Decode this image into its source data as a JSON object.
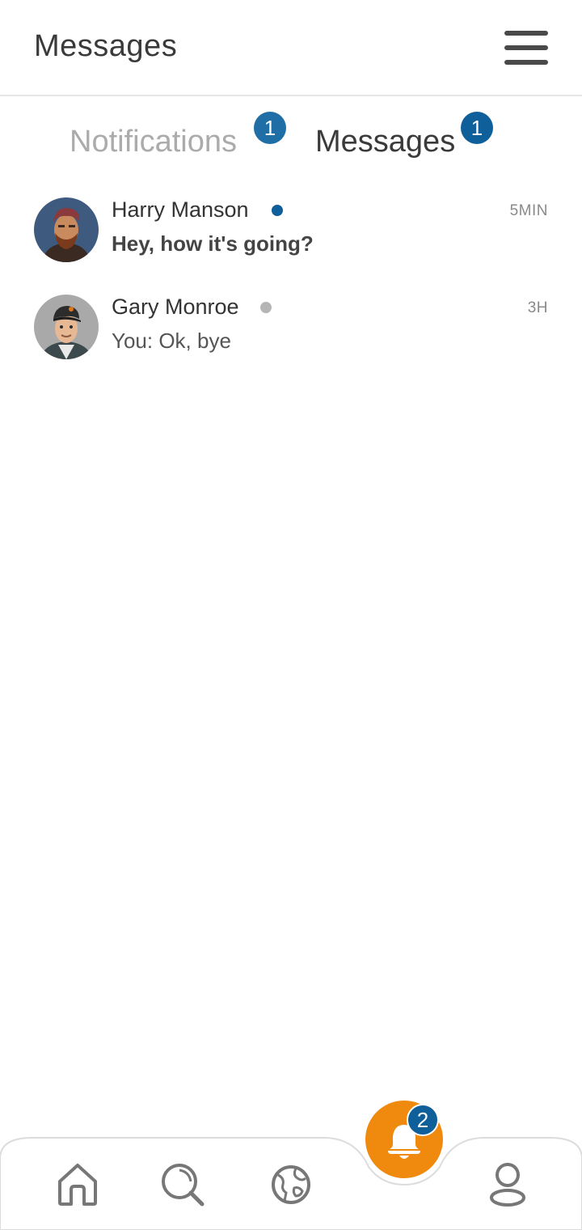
{
  "header": {
    "title": "Messages",
    "menu_icon": "hamburger-menu-icon"
  },
  "tabs": [
    {
      "label": "Notifications",
      "badge": "1",
      "active": false
    },
    {
      "label": "Messages",
      "badge": "1",
      "active": true
    }
  ],
  "conversations": [
    {
      "name": "Harry Manson",
      "preview": "Hey, how it's going?",
      "time": "5MIN",
      "online": true,
      "unread": true,
      "status_color": "#0f5f9b"
    },
    {
      "name": "Gary Monroe",
      "preview": "You: Ok, bye",
      "time": "3H",
      "online": false,
      "unread": false,
      "status_color": "#b5b5b5"
    }
  ],
  "bottom_nav": {
    "items": [
      "home-icon",
      "search-icon",
      "globe-icon",
      "bell-icon",
      "profile-icon"
    ],
    "notification_badge": "2",
    "accent": "#f08a0e"
  },
  "colors": {
    "badge_blue": "#0f5f9b",
    "accent_orange": "#f08a0e",
    "muted_text": "#ababab"
  }
}
